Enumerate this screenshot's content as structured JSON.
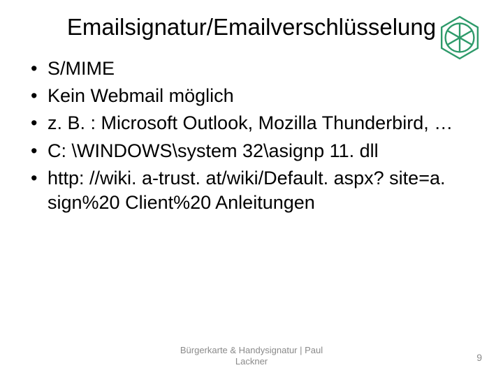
{
  "title": "Emailsignatur/Emailverschlüsselung",
  "logo": {
    "color": "#2e9a6a",
    "name": "hexagon-wheel-icon"
  },
  "bullets": [
    "S/MIME",
    "Kein Webmail möglich",
    "z. B. : Microsoft Outlook, Mozilla Thunderbird, …",
    "C: \\WINDOWS\\system 32\\asignp 11. dll",
    "http: //wiki. a-trust. at/wiki/Default. aspx? site=a. sign%20 Client%20 Anleitungen"
  ],
  "footer": {
    "line1": "Bürgerkarte & Handysignatur | Paul",
    "line2": "Lackner"
  },
  "page_number": "9"
}
